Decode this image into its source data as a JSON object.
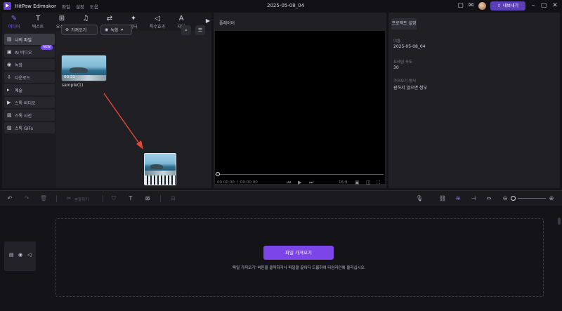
{
  "titlebar": {
    "app_title": "HitPaw Edimakor",
    "menu": [
      "파일",
      "설정",
      "도움"
    ],
    "document_title": "2025-05-08_04",
    "export_label": "내보내기"
  },
  "toolbar_tabs": [
    {
      "label": "미디어",
      "icon": "✎"
    },
    {
      "label": "텍스트",
      "icon": "T"
    },
    {
      "label": "요소들",
      "icon": "⊞"
    },
    {
      "label": "오디오",
      "icon": "♫"
    },
    {
      "label": "장면전환",
      "icon": "⇄"
    },
    {
      "label": "필터",
      "icon": "✦"
    },
    {
      "label": "특수효과",
      "icon": "◁"
    },
    {
      "label": "자막",
      "icon": "A"
    }
  ],
  "sidebar": [
    {
      "label": "나의 파일",
      "icon": "▤",
      "active": true
    },
    {
      "label": "AI 비디오",
      "icon": "▣",
      "badge": "NEW"
    },
    {
      "label": "녹화",
      "icon": "◉"
    },
    {
      "label": "다운로드",
      "icon": "⇩"
    },
    {
      "label": "예술",
      "icon": "▸"
    },
    {
      "label": "스톡 비디오",
      "icon": "▶"
    },
    {
      "label": "스톡 사진",
      "icon": "▨"
    },
    {
      "label": "스톡 GIFs",
      "icon": "▨"
    }
  ],
  "media": {
    "import_label": "가져오기",
    "record_label": "녹화",
    "item": {
      "name": "sample(1)",
      "duration": "00:31"
    }
  },
  "player": {
    "title": "플레이어",
    "time_current": "00:00:00",
    "time_total": "00:00:00",
    "ratio": "16:9"
  },
  "properties": {
    "tab": "프로젝트 설정",
    "fields": [
      {
        "label": "이름",
        "value": "2025-05-08_04"
      },
      {
        "label": "프레임 속도",
        "value": "30"
      },
      {
        "label": "가져오기 방식",
        "value": "원하지 않으면 첨부"
      }
    ]
  },
  "timeline_toolbar": {
    "split_label": "분할하기"
  },
  "timeline": {
    "import_button": "파일 가져오기",
    "hint": "'파일 가져오기' 버튼을 클릭하거나 파일을 끌어다 드롭하여 타임라인에 올리십시오."
  },
  "colors": {
    "accent": "#7b45e8",
    "background": "#141418",
    "panel": "#1f1f24"
  }
}
